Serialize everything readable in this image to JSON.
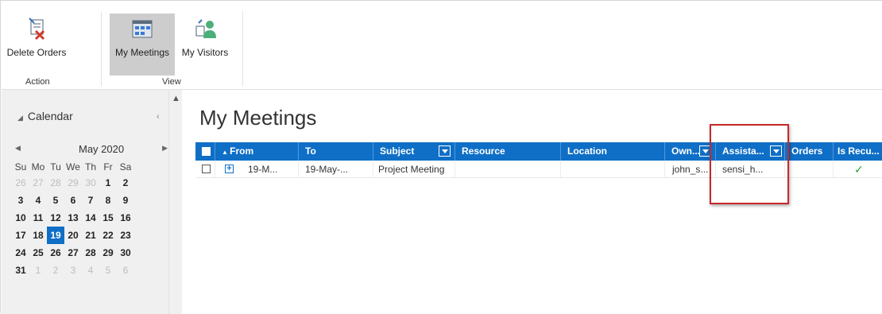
{
  "ribbon": {
    "buttons": {
      "delete_orders": "Delete Orders",
      "my_meetings": "My Meetings",
      "my_visitors": "My Visitors"
    },
    "groups": {
      "action": "Action",
      "view": "View"
    }
  },
  "sidebar": {
    "calendar_label": "Calendar",
    "month_title": "May 2020",
    "weekdays": [
      "Su",
      "Mo",
      "Tu",
      "We",
      "Th",
      "Fr",
      "Sa"
    ],
    "weeks": [
      [
        "26",
        "27",
        "28",
        "29",
        "30",
        "1",
        "2"
      ],
      [
        "3",
        "4",
        "5",
        "6",
        "7",
        "8",
        "9"
      ],
      [
        "10",
        "11",
        "12",
        "13",
        "14",
        "15",
        "16"
      ],
      [
        "17",
        "18",
        "19",
        "20",
        "21",
        "22",
        "23"
      ],
      [
        "24",
        "25",
        "26",
        "27",
        "28",
        "29",
        "30"
      ],
      [
        "31",
        "1",
        "2",
        "3",
        "4",
        "5",
        "6"
      ]
    ],
    "selected_day": "19"
  },
  "main": {
    "title": "My Meetings",
    "columns": {
      "from": "From",
      "to": "To",
      "subject": "Subject",
      "resource": "Resource",
      "location": "Location",
      "owner": "Own...",
      "assistant": "Assista...",
      "orders": "Orders",
      "is_recurring": "Is Recu..."
    },
    "rows": [
      {
        "from": "19-M...",
        "to": "19-May-...",
        "subject": "Project Meeting",
        "resource": "",
        "location": "",
        "owner": "john_s...",
        "assistant": "sensi_h...",
        "orders": "",
        "is_recurring": "✓"
      }
    ]
  },
  "colors": {
    "accent": "#0f6fc6",
    "highlight_box": "#c62828",
    "check": "#2a9d2a"
  }
}
